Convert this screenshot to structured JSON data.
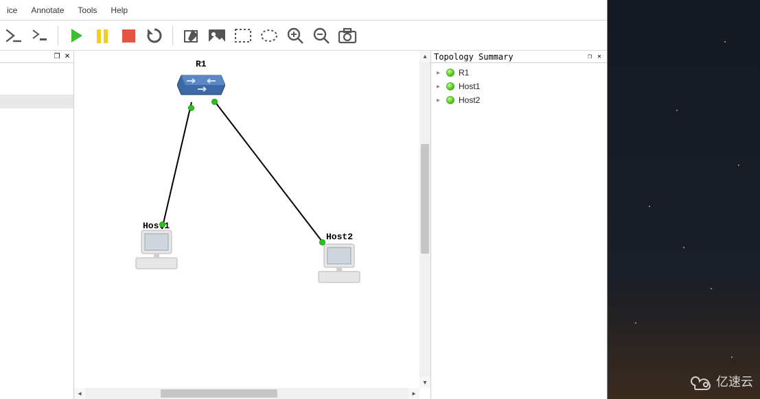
{
  "menu": {
    "items": [
      "ice",
      "Annotate",
      "Tools",
      "Help"
    ]
  },
  "toolbar": {
    "icons": [
      "console-prompt-icon",
      "console-mini-icon",
      "play-icon",
      "pause-icon",
      "stop-icon",
      "reload-icon",
      "edit-box-icon",
      "image-icon",
      "rect-select-icon",
      "ellipse-select-icon",
      "zoom-in-icon",
      "zoom-out-icon",
      "camera-icon"
    ]
  },
  "panels": {
    "left": {
      "restore_title": "Restore",
      "close_title": "Close"
    },
    "topology": {
      "title": "Topology Summary"
    }
  },
  "topology": {
    "nodes": {
      "router": {
        "label": "R1"
      },
      "host1": {
        "label": "Host1"
      },
      "host2": {
        "label": "Host2"
      }
    },
    "tree": [
      {
        "label": "R1"
      },
      {
        "label": "Host1"
      },
      {
        "label": "Host2"
      }
    ]
  },
  "watermark": {
    "text": "亿速云"
  }
}
